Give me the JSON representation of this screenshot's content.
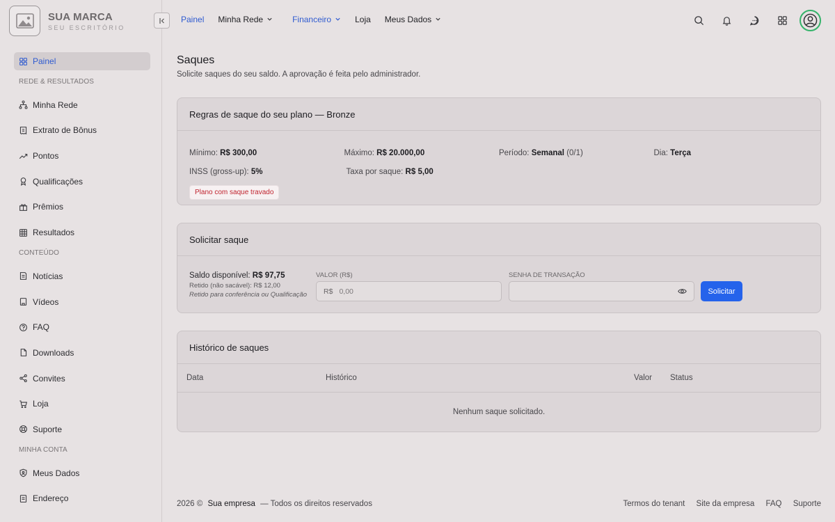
{
  "brand": {
    "name": "SUA MARCA",
    "subtitle": "SEU ESCRITÓRIO"
  },
  "sidebar": {
    "items": [
      {
        "label": "Painel",
        "icon": "grid-icon",
        "active": true
      },
      {
        "section": "REDE & RESULTADOS"
      },
      {
        "label": "Minha Rede",
        "icon": "network-icon"
      },
      {
        "label": "Extrato de Bônus",
        "icon": "receipt-icon"
      },
      {
        "label": "Pontos",
        "icon": "trending-icon"
      },
      {
        "label": "Qualificações",
        "icon": "award-icon"
      },
      {
        "label": "Prêmios",
        "icon": "gift-icon"
      },
      {
        "label": "Resultados",
        "icon": "table-icon"
      },
      {
        "section": "CONTEÚDO"
      },
      {
        "label": "Notícias",
        "icon": "news-icon"
      },
      {
        "label": "Vídeos",
        "icon": "video-icon"
      },
      {
        "label": "FAQ",
        "icon": "help-icon"
      },
      {
        "label": "Downloads",
        "icon": "file-icon"
      },
      {
        "label": "Convites",
        "icon": "share-icon"
      },
      {
        "label": "Loja",
        "icon": "cart-icon"
      },
      {
        "label": "Suporte",
        "icon": "lifebuoy-icon"
      },
      {
        "section": "MINHA CONTA"
      },
      {
        "label": "Meus Dados",
        "icon": "shield-user-icon"
      },
      {
        "label": "Endereço",
        "icon": "address-icon"
      }
    ]
  },
  "topnav": {
    "items": [
      {
        "label": "Painel",
        "blue": true,
        "dropdown": false
      },
      {
        "label": "Minha Rede",
        "blue": false,
        "dropdown": true
      },
      {
        "label": "Financeiro",
        "blue": true,
        "dropdown": true
      },
      {
        "label": "Loja",
        "blue": false,
        "dropdown": false
      },
      {
        "label": "Meus Dados",
        "blue": false,
        "dropdown": true
      }
    ]
  },
  "page": {
    "title": "Saques",
    "subtitle": "Solicite saques do seu saldo. A aprovação é feita pelo administrador."
  },
  "rules": {
    "title": "Regras de saque do seu plano — Bronze",
    "minimo_label": "Mínimo:",
    "minimo_value": "R$ 300,00",
    "maximo_label": "Máximo:",
    "maximo_value": "R$ 20.000,00",
    "periodo_label": "Período:",
    "periodo_value": "Semanal",
    "periodo_extra": " (0/1)",
    "dia_label": "Dia:",
    "dia_value": "Terça",
    "inss_label": "INSS (gross-up):",
    "inss_value": "5%",
    "taxa_label": "Taxa por saque:",
    "taxa_value": "R$ 5,00",
    "badge": "Plano com saque travado"
  },
  "solicitar": {
    "title": "Solicitar saque",
    "saldo_label": "Saldo disponível:",
    "saldo_value": "R$ 97,75",
    "retido": "Retido (não sacável): R$ 12,00",
    "retido_note": "Retido para conferência ou Qualificação",
    "valor_label": "VALOR (R$)",
    "valor_prefix": "R$",
    "valor_placeholder": "0,00",
    "senha_label": "SENHA DE TRANSAÇÃO",
    "button": "Solicitar",
    "button_color": "#2563eb"
  },
  "historico": {
    "title": "Histórico de saques",
    "columns": [
      "Data",
      "Histórico",
      "Valor",
      "Status"
    ],
    "empty": "Nenhum saque solicitado."
  },
  "footer": {
    "year": "2026 ©",
    "company": "Sua empresa",
    "rights": "— Todos os direitos reservados",
    "links": [
      "Termos do tenant",
      "Site da empresa",
      "FAQ",
      "Suporte"
    ]
  }
}
